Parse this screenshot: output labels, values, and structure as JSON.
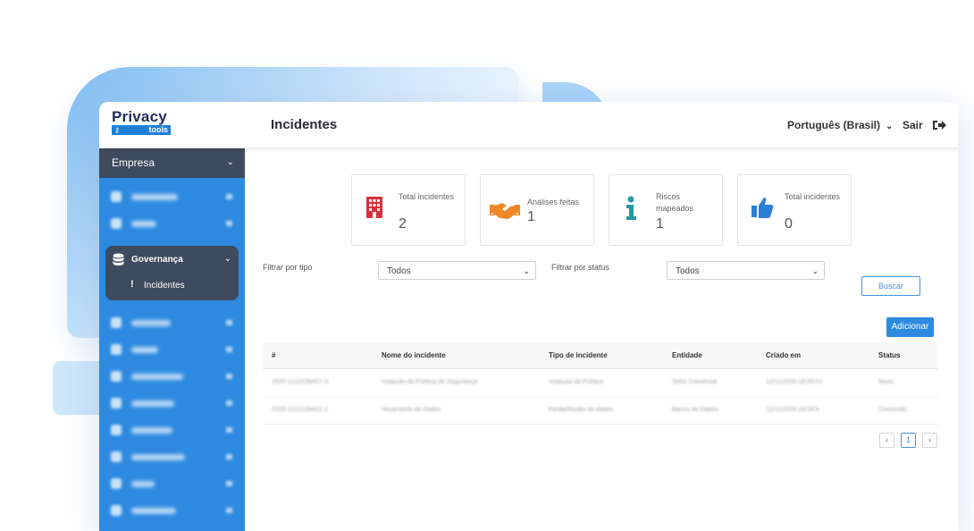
{
  "app": {
    "logo_word": "Privacy",
    "logo_sub": "tools",
    "page_title": "Incidentes",
    "language": "Português (Brasil)",
    "logout": "Sair"
  },
  "sidebar": {
    "company": "Empresa",
    "group": "Governança",
    "group_sub": "Incidentes"
  },
  "stats": [
    {
      "label": "Total incidentes",
      "value": "2",
      "icon": "building-icon",
      "color": "#d8303a"
    },
    {
      "label": "Análises feitas",
      "value": "1",
      "icon": "handshake-icon",
      "color": "#f0882a"
    },
    {
      "label": "Riscos mapeados",
      "value": "1",
      "icon": "info-icon",
      "color": "#1e9aa0"
    },
    {
      "label": "Total incidentes",
      "value": "0",
      "icon": "thumbs-up-icon",
      "color": "#2d7fd6"
    }
  ],
  "filters": {
    "type_label": "Filtrar por tipo",
    "type_value": "Todos",
    "status_label": "Filtrar por status",
    "status_value": "Todos",
    "search_button": "Buscar",
    "add_button": "Adicionar"
  },
  "table": {
    "headers": [
      "#",
      "Nome do incidente",
      "Tipo de incidente",
      "Entidade",
      "Criado em",
      "Status"
    ],
    "rows": [
      [
        "2020-11121094D7-3",
        "Violação de Política de Segurança",
        "Violação de Política",
        "Setor Comercial",
        "12/11/2020 18:00:07",
        "Novo"
      ],
      [
        "2020-11121094D1-2",
        "Vazamento de Dados",
        "Perda/Roubo de dados",
        "Banco de Dados",
        "12/11/2020 18:04:5",
        "Concluído"
      ]
    ]
  },
  "pagination": {
    "prev": "‹",
    "current": "1",
    "next": "›"
  },
  "colors": {
    "sidebar_bg": "#2d8ae0",
    "sidebar_dark": "#3e4a5e",
    "accent": "#2d8ae0"
  }
}
